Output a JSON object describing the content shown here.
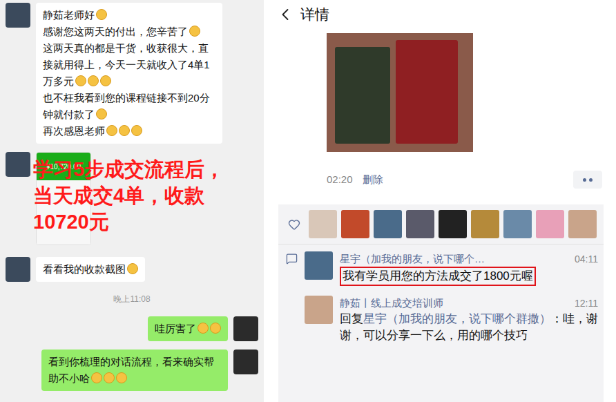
{
  "chat": {
    "messages": [
      {
        "side": "left",
        "kind": "text",
        "lines": [
          {
            "text": "静茹老师好",
            "emoji": 1
          },
          {
            "text": "感谢您这两天的付出，您辛苦了",
            "emoji": 1
          },
          {
            "text": "这两天真的都是干货，收获很大，直接就用得上，今天一天就收入了4单1万多元",
            "emoji": 3
          },
          {
            "text": "也不枉我看到您的课程链接不到20分钟就付款了",
            "emoji": 1
          },
          {
            "text": "再次感恩老师",
            "emoji": 3
          }
        ]
      },
      {
        "side": "left",
        "kind": "image",
        "amount": "¥10,720.00"
      },
      {
        "side": "left",
        "kind": "text",
        "lines": [
          {
            "text": "看看我的收款截图",
            "emoji": 1
          }
        ]
      },
      {
        "side": "center",
        "kind": "time",
        "text": "晚上11:08"
      },
      {
        "side": "right",
        "kind": "text",
        "lines": [
          {
            "text": "哇厉害了",
            "emoji": 2
          }
        ]
      },
      {
        "side": "right",
        "kind": "text",
        "lines": [
          {
            "text": "看到你梳理的对话流程，看来确实帮助不小哈",
            "emoji": 3
          }
        ]
      }
    ],
    "annotation": "学习5步成交流程后，当天成交4单，收款10720元"
  },
  "detail": {
    "title": "详情",
    "post_time": "02:20",
    "delete": "删除",
    "liker_count": 9,
    "comments": [
      {
        "name": "星宇（加我的朋友，说下哪个…",
        "time": "04:11",
        "reply_label": "",
        "reply_to": "",
        "text": "我有学员用您的方法成交了1800元喔",
        "highlighted": true
      },
      {
        "name": "静茹丨线上成交培训师",
        "time": "12:11",
        "reply_label": "回复",
        "reply_to": "星宇（加我的朋友，说下哪个群撒）",
        "text": "：哇，谢谢，可以分享一下么，用的哪个技巧",
        "highlighted": false
      }
    ]
  }
}
